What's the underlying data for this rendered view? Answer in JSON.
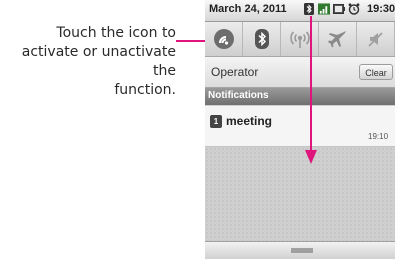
{
  "callout": {
    "line1": "Touch the icon to",
    "line2": "activate or unactivate the",
    "line3": "function."
  },
  "statusbar": {
    "date": "March 24, 2011",
    "time": "19:30",
    "icons": [
      "bluetooth-status-icon",
      "signal-icon",
      "battery-icon",
      "alarm-icon"
    ]
  },
  "toggles": [
    {
      "name": "wifi-toggle",
      "icon": "wifi-icon"
    },
    {
      "name": "bluetooth-toggle",
      "icon": "bluetooth-icon"
    },
    {
      "name": "gps-toggle",
      "icon": "gps-icon"
    },
    {
      "name": "airplane-toggle",
      "icon": "airplane-icon"
    },
    {
      "name": "silent-toggle",
      "icon": "silent-icon"
    }
  ],
  "operator": {
    "label": "Operator",
    "clear_label": "Clear"
  },
  "notifications": {
    "header": "Notifications",
    "items": [
      {
        "title": "meeting",
        "time": "19:10",
        "icon": "calendar-icon",
        "icon_text": "1"
      }
    ]
  },
  "colors": {
    "accent": "#e0147d"
  }
}
